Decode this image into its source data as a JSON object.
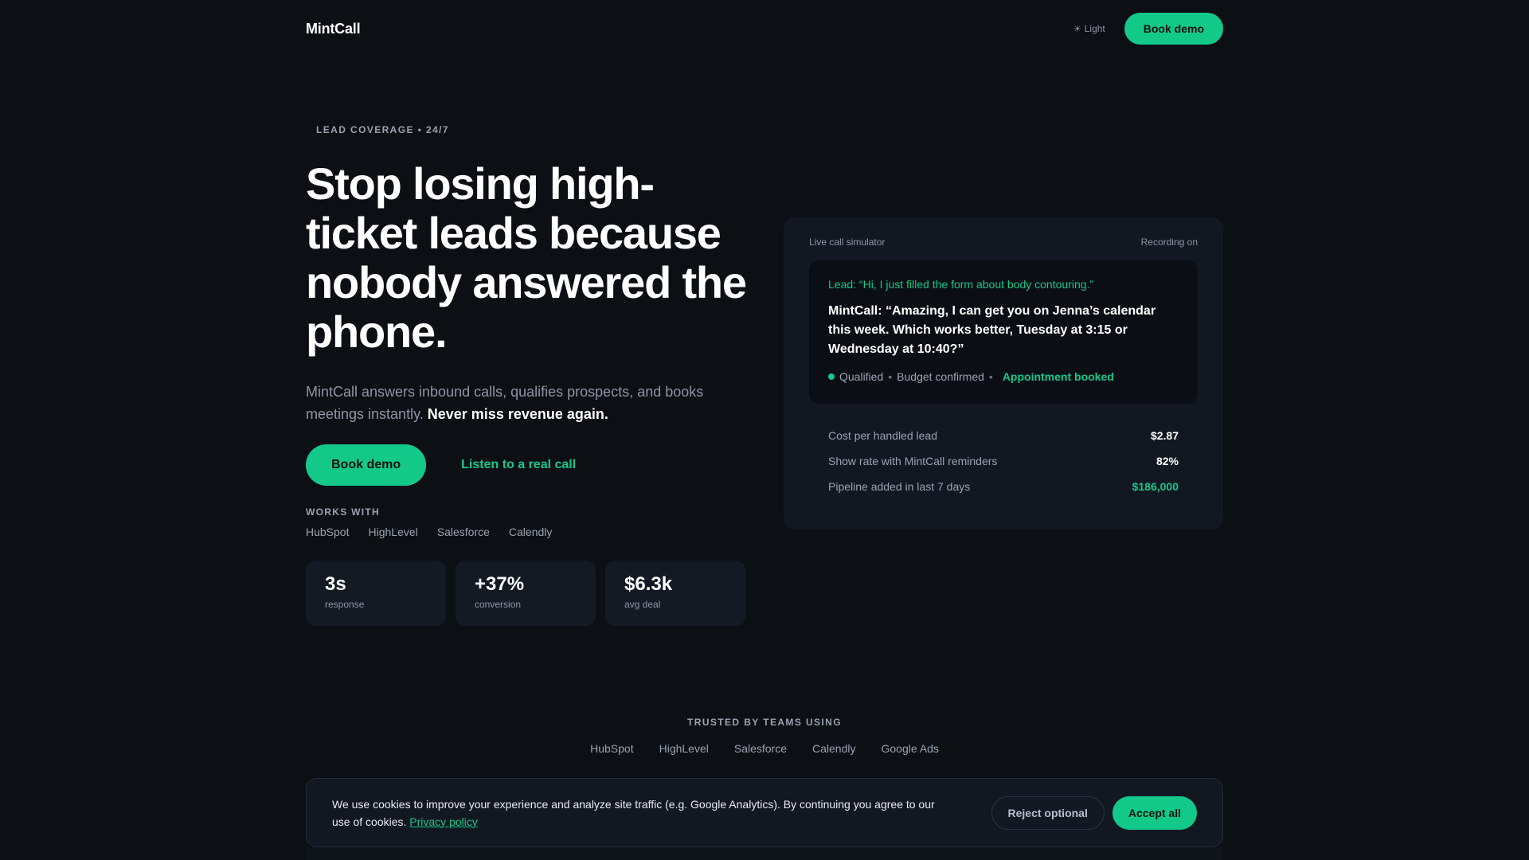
{
  "nav": {
    "brand": "MintCall",
    "theme_icon": "sun-icon",
    "theme_label": "Light",
    "cta": "Book demo"
  },
  "hero": {
    "eyebrow": "LEAD COVERAGE • 24/7",
    "headline": "Stop losing high-ticket leads because nobody answered the phone.",
    "subhead": "MintCall answers inbound calls, qualifies prospects, and books meetings instantly.",
    "subhead_emphasis": "Never miss revenue again.",
    "primary_cta": "Book demo",
    "secondary_cta": "Listen to a real call",
    "works_with_label": "WORKS WITH",
    "works_with": [
      "HubSpot",
      "HighLevel",
      "Salesforce",
      "Calendly"
    ],
    "stats": [
      {
        "value": "3s",
        "label": "response"
      },
      {
        "value": "+37%",
        "label": "conversion"
      },
      {
        "value": "$6.3k",
        "label": "avg deal"
      }
    ]
  },
  "simulator": {
    "title": "Live call simulator",
    "status": "Recording on",
    "lead_line": "Lead: “Hi, I just filled the form about body contouring.”",
    "bot_line": "MintCall: “Amazing, I can get you on Jenna’s calendar this week. Which works better, Tuesday at 3:15 or Wednesday at 10:40?”",
    "tags": [
      "Qualified",
      "Budget confirmed"
    ],
    "tag_separator": "•",
    "booked": "Appointment booked",
    "metrics": [
      {
        "label": "Cost per handled lead",
        "value": "$2.87"
      },
      {
        "label": "Show rate with MintCall reminders",
        "value": "82%"
      },
      {
        "label": "Pipeline added in last 7 days",
        "value": "$186,000"
      }
    ]
  },
  "trusted": {
    "label": "TRUSTED BY TEAMS USING",
    "logos": [
      "HubSpot",
      "HighLevel",
      "Salesforce",
      "Calendly",
      "Google Ads"
    ]
  },
  "cookie": {
    "text": "We use cookies to improve your experience and analyze site traffic (e.g. Google Analytics). By continuing you agree to our use of cookies.",
    "policy_link": "Privacy policy",
    "reject": "Reject optional",
    "accept": "Accept all"
  },
  "colors": {
    "background": "#0c0f14",
    "accent": "#12c98a",
    "card": "#121822"
  }
}
